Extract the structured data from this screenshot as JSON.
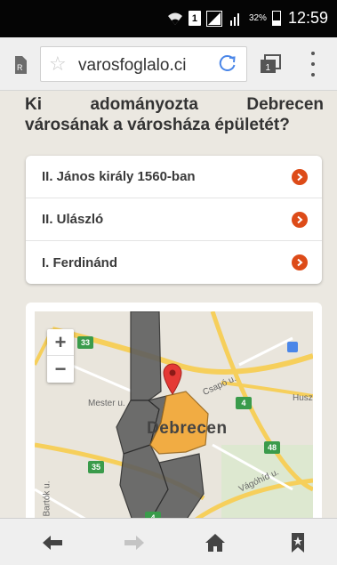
{
  "status_bar": {
    "battery_percent": "32%",
    "battery_level": 0.32,
    "sim_label": "1",
    "time": "12:59",
    "icons": [
      "wifi-icon",
      "sim-icon",
      "signal-icon",
      "signal-icon",
      "battery-icon"
    ]
  },
  "browser": {
    "url": "varosfoglalo.ci",
    "icons": [
      "page-icon",
      "star-icon",
      "reload-icon",
      "tabs-icon",
      "menu-icon"
    ],
    "tab_count": "1"
  },
  "quiz": {
    "question": "Ki adományozta Debrecen városának a városháza épületét?",
    "answers": [
      {
        "label": "II. János király 1560-ban"
      },
      {
        "label": "II. Ulászló"
      },
      {
        "label": "I. Ferdinánd"
      }
    ],
    "answer_icon": "chevron-right-icon",
    "accent_color": "#dd4b18"
  },
  "map": {
    "zoom_in": "+",
    "zoom_out": "−",
    "city_label": "Debrecen",
    "street_labels": [
      "Mester u.",
      "Csapó u.",
      "Husz",
      "Vágóhíd u.",
      "Bartók u."
    ],
    "road_numbers": [
      "33",
      "4",
      "35",
      "48",
      "4"
    ],
    "poi_icon": "info-poi-icon",
    "marker_icon": "location-pin-icon"
  },
  "bottom_nav": {
    "icons": [
      "back-arrow-icon",
      "forward-arrow-icon",
      "home-icon",
      "bookmark-icon"
    ]
  }
}
